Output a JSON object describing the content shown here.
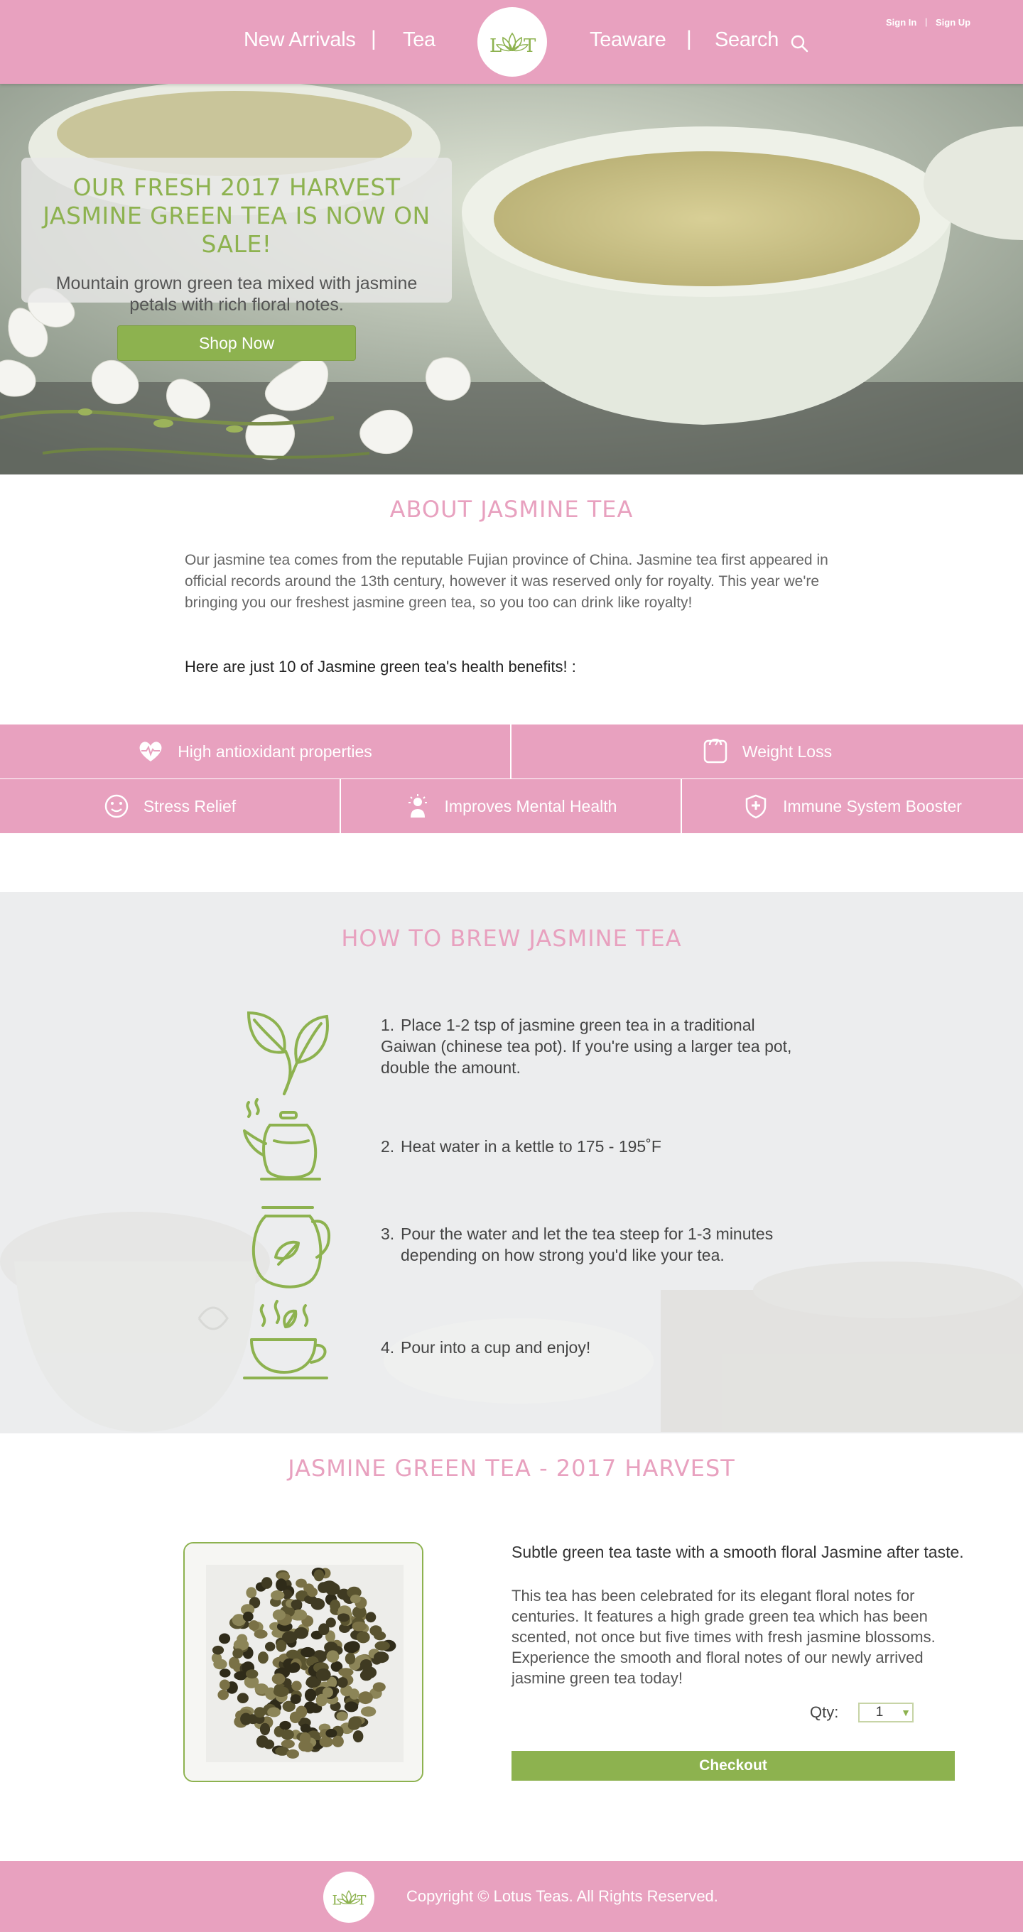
{
  "nav": {
    "new_arrivals": "New Arrivals",
    "tea": "Tea",
    "teaware": "Teaware",
    "search": "Search",
    "separator": "|",
    "sign_in": "Sign In",
    "sign_up": "Sign Up",
    "auth_separator": "|"
  },
  "logo": {
    "letters": "LT"
  },
  "hero": {
    "title": "Our Fresh 2017 Harvest Jasmine Green Tea is now on sale!",
    "subtitle": "Mountain grown green tea mixed with jasmine petals with rich floral notes.",
    "cta": "Shop Now"
  },
  "about": {
    "title": "About Jasmine Tea",
    "text": "Our jasmine tea comes from the reputable Fujian province of China. Jasmine tea first appeared in official records around the 13th century, however it was reserved only for royalty. This year we're bringing you our freshest jasmine green tea, so you too can drink like royalty!",
    "benefits_intro": "Here are just 10 of Jasmine green tea's health benefits! :"
  },
  "benefits": [
    {
      "label": "High antioxidant properties",
      "icon": "heart-pulse-icon"
    },
    {
      "label": "Weight Loss",
      "icon": "scale-icon"
    },
    {
      "label": "Stress Relief",
      "icon": "smiley-icon"
    },
    {
      "label": "Improves Mental Health",
      "icon": "lightbulb-person-icon"
    },
    {
      "label": "Immune System Booster",
      "icon": "shield-plus-icon"
    }
  ],
  "brew": {
    "title": "How to Brew Jasmine Tea",
    "steps": [
      {
        "num": "1.",
        "text": "Place 1-2 tsp of jasmine green tea in a traditional Gaiwan (chinese tea pot). If you're using a larger tea pot, double  the amount.",
        "icon": "tea-leaves-icon"
      },
      {
        "num": "2.",
        "text": "Heat water in a kettle to 175 - 195˚F",
        "icon": "kettle-icon"
      },
      {
        "num": "3.",
        "text": "Pour the water and let the tea steep for 1-3 minutes depending on how strong you'd like your tea.",
        "icon": "teapot-icon"
      },
      {
        "num": "4.",
        "text": "Pour into a cup and enjoy!",
        "icon": "tea-cup-icon"
      }
    ]
  },
  "product": {
    "title": "Jasmine Green Tea - 2017 Harvest",
    "tagline": "Subtle green tea taste with a smooth floral Jasmine after taste.",
    "description": "This tea has been celebrated for its elegant floral notes for centuries. It features a high grade green tea which has been scented, not once but five times with fresh jasmine blossoms. Experience the smooth and floral notes of our newly arrived jasmine green tea today!",
    "qty_label": "Qty:",
    "qty_value": "1",
    "checkout": "Checkout"
  },
  "footer": {
    "copyright": "Copyright © Lotus Teas. All Rights Reserved."
  },
  "colors": {
    "pink": "#e8a1bf",
    "green": "#8db24f",
    "brew_bg": "#ecedee"
  }
}
